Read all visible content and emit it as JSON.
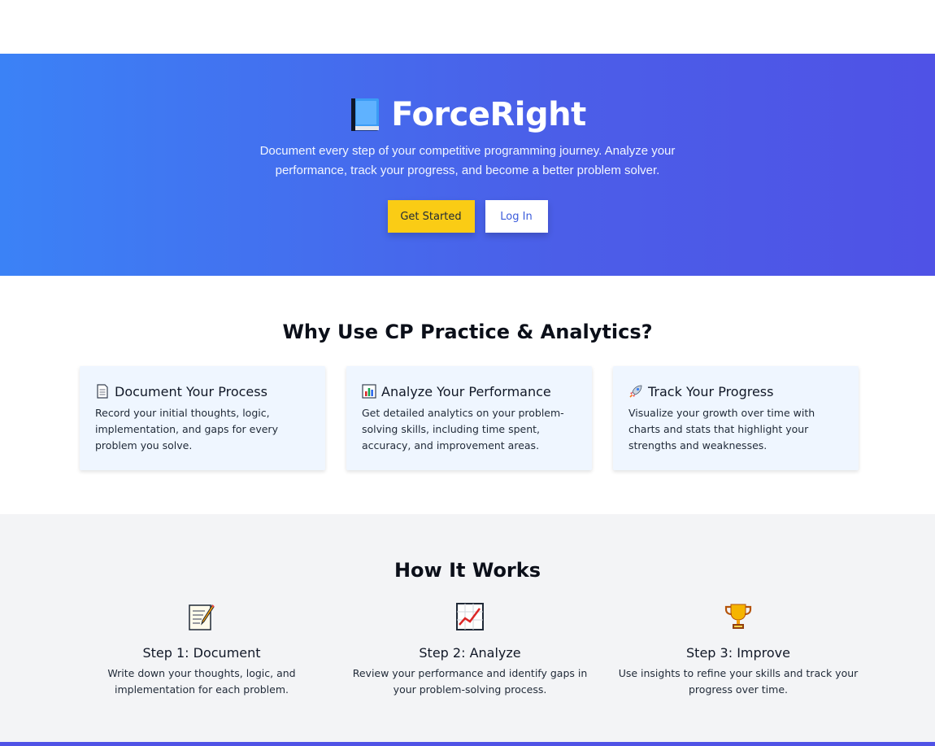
{
  "hero": {
    "title": "ForceRight",
    "subtitle": "Document every step of your competitive programming journey. Analyze your performance, track your progress, and become a better problem solver.",
    "cta_primary": "Get Started",
    "cta_secondary": "Log In",
    "icon": "book-icon",
    "gradient_start": "#3b82f6",
    "gradient_end": "#4f52e6",
    "primary_color": "#facc15"
  },
  "features": {
    "title": "Why Use CP Practice & Analytics?",
    "cards": [
      {
        "icon": "page-icon",
        "title": "Document Your Process",
        "text": "Record your initial thoughts, logic, implementation, and gaps for every problem you solve."
      },
      {
        "icon": "bar-chart-icon",
        "title": "Analyze Your Performance",
        "text": "Get detailed analytics on your problem-solving skills, including time spent, accuracy, and improvement areas."
      },
      {
        "icon": "rocket-icon",
        "title": "Track Your Progress",
        "text": "Visualize your growth over time with charts and stats that highlight your strengths and weaknesses."
      }
    ]
  },
  "how": {
    "title": "How It Works",
    "steps": [
      {
        "icon": "memo-icon",
        "title": "Step 1: Document",
        "text": "Write down your thoughts, logic, and implementation for each problem."
      },
      {
        "icon": "line-chart-icon",
        "title": "Step 2: Analyze",
        "text": "Review your performance and identify gaps in your problem-solving process."
      },
      {
        "icon": "trophy-icon",
        "title": "Step 3: Improve",
        "text": "Use insights to refine your skills and track your progress over time."
      }
    ]
  }
}
